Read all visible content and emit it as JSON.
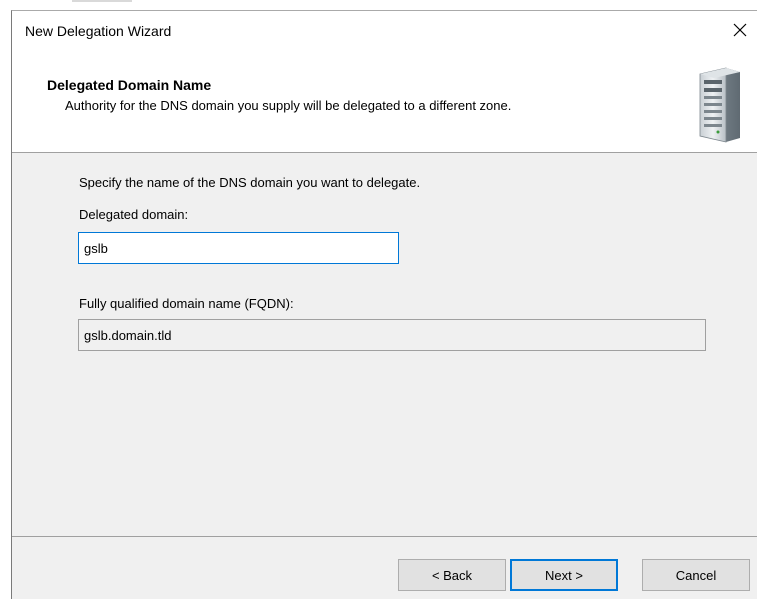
{
  "window": {
    "title": "New Delegation Wizard"
  },
  "header": {
    "title": "Delegated Domain Name",
    "subtitle": "Authority for the DNS domain you supply will be delegated to a different zone.",
    "icon": "server-icon"
  },
  "main": {
    "instruction": "Specify the name of the DNS domain you want to delegate.",
    "delegated_domain": {
      "label": "Delegated domain:",
      "value": "gslb"
    },
    "fqdn": {
      "label": "Fully qualified domain name (FQDN):",
      "value": "gslb.domain.tld"
    }
  },
  "buttons": {
    "back": "< Back",
    "next": "Next >",
    "cancel": "Cancel"
  },
  "colors": {
    "accent": "#0078d7",
    "dialog_background": "#f0f0f0",
    "header_background": "#ffffff"
  }
}
